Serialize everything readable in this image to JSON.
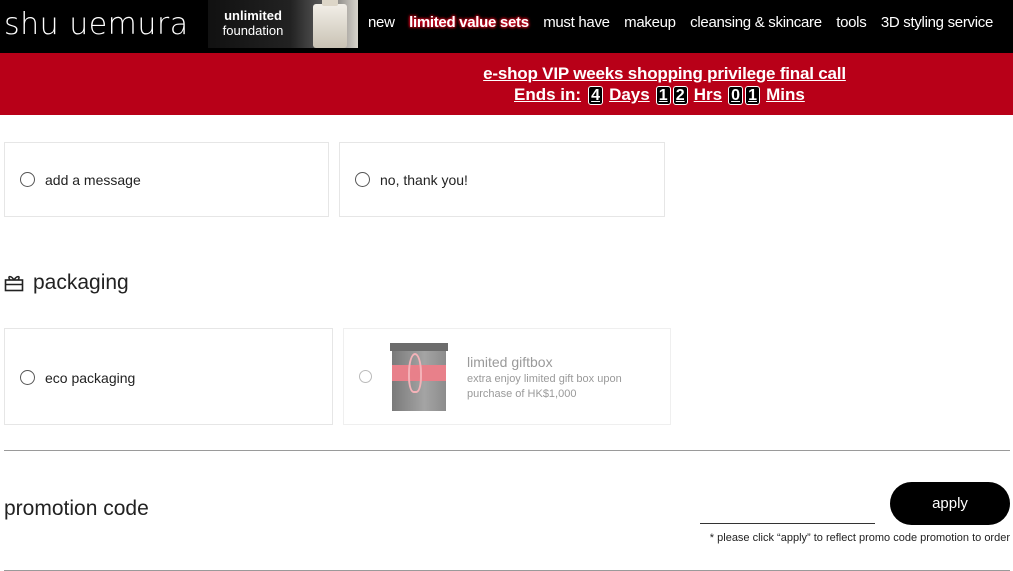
{
  "header": {
    "logo": "shu uemura",
    "banner_line1": "unlimited",
    "banner_line2": "foundation",
    "nav": [
      "new",
      "limited value sets",
      "must have",
      "makeup",
      "cleansing & skincare",
      "tools",
      "3D styling service"
    ]
  },
  "announcement": {
    "headline": "e-shop VIP weeks shopping privilege final call",
    "ends_label": "Ends in:",
    "days_digits": [
      "4"
    ],
    "days_label": "Days",
    "hours_digits": [
      "1",
      "2"
    ],
    "hours_label": "Hrs",
    "mins_digits": [
      "0",
      "1"
    ],
    "mins_label": "Mins"
  },
  "message_options": [
    "add a message",
    "no, thank you!"
  ],
  "packaging": {
    "title": "packaging",
    "options": {
      "eco": "eco packaging",
      "giftbox_title": "limited giftbox",
      "giftbox_desc": "extra enjoy limited gift box upon purchase of HK$1,000"
    }
  },
  "promotion": {
    "title": "promotion code",
    "input_value": "",
    "apply_label": "apply",
    "note": "* please click “apply” to reflect promo code promotion to order"
  },
  "colors": {
    "brand_red": "#b80018",
    "nav_bg": "#000000"
  }
}
